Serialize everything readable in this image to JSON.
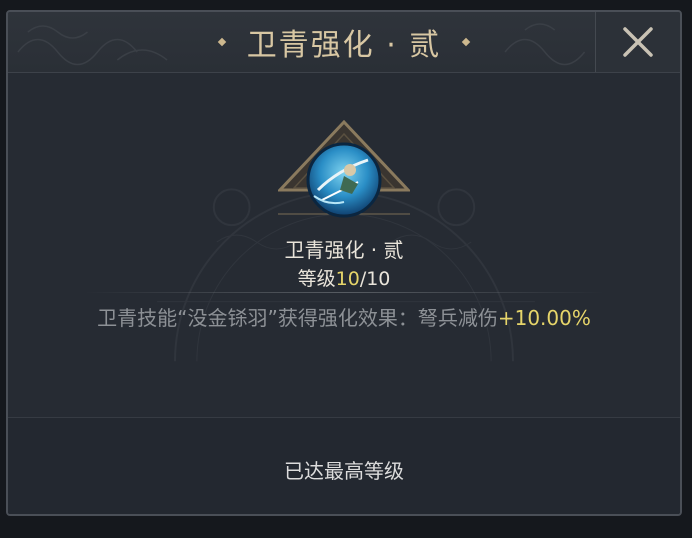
{
  "dialog": {
    "title": "卫青强化 · 贰",
    "close_icon": "close-icon"
  },
  "skill": {
    "name": "卫青强化 · 贰",
    "icon": "archer-skill-icon",
    "level_prefix": "等级",
    "level_current": "10",
    "level_max": "/10",
    "description": "卫青技能“没金铩羽”获得强化效果：弩兵减伤",
    "bonus": "+10.00%"
  },
  "footer": {
    "status": "已达最高等级"
  },
  "colors": {
    "title": "#d8c7a3",
    "highlight": "#e6d56a",
    "description": "#8d9196",
    "panel": "#262b33"
  }
}
